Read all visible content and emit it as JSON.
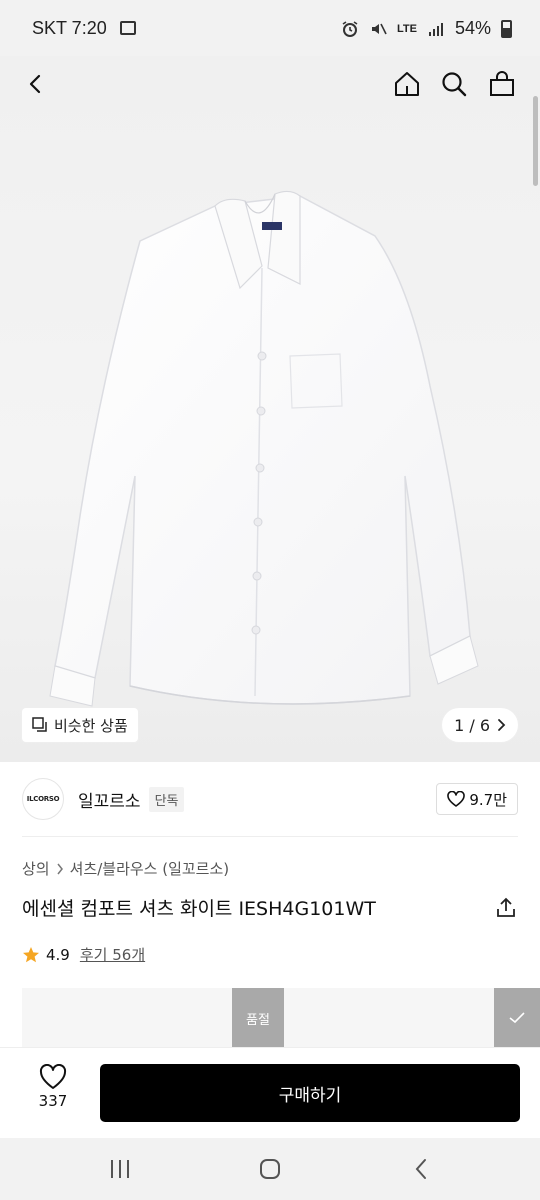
{
  "status_bar": {
    "time": "SKT 7:20",
    "network": "LTE",
    "battery": "54%"
  },
  "header": {
    "icons": [
      "back-icon",
      "home-icon",
      "search-icon",
      "shopping-bag-icon"
    ]
  },
  "gallery": {
    "similar_label": "비슷한 상품",
    "pager": "1 / 6"
  },
  "brand": {
    "logo_text": "ILCORSO",
    "name": "일꼬르소",
    "badge": "단독",
    "likes": "9.7만"
  },
  "product": {
    "breadcrumb": [
      "상의",
      "셔츠/블라우스 (일꼬르소)"
    ],
    "title": "에센셜 컴포트 셔츠 화이트 IESH4G101WT",
    "rating": "4.9",
    "reviews_label": "후기 56개"
  },
  "options": {
    "soldout_label": "품절"
  },
  "action_bar": {
    "wish_count": "337",
    "buy_label": "구매하기"
  },
  "colors": {
    "buy_button": "#000000",
    "star": "#f5a623",
    "soldout": "#a9a9a9"
  }
}
